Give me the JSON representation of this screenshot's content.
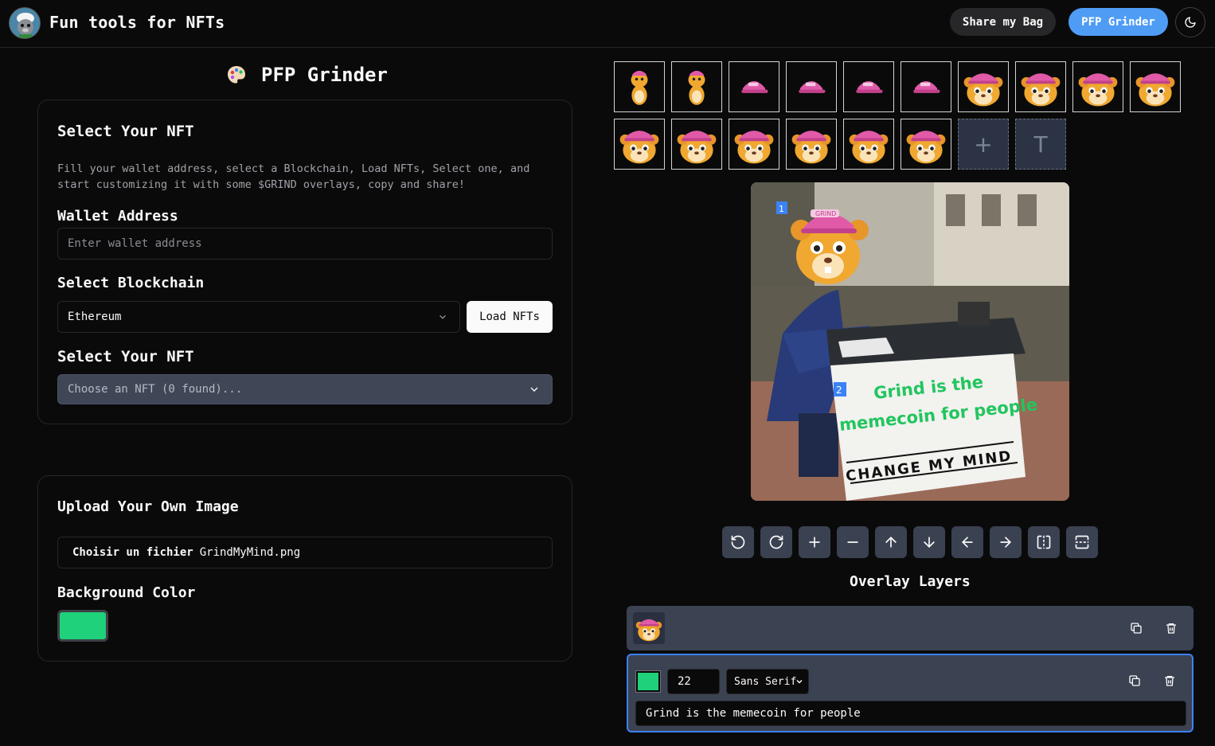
{
  "header": {
    "app_title": "Fun tools for NFTs",
    "share_label": "Share my Bag",
    "pfp_label": "PFP Grinder",
    "theme_icon": "moon-icon"
  },
  "page": {
    "title": "PFP Grinder",
    "title_icon": "palette-icon"
  },
  "select_card": {
    "heading": "Select Your NFT",
    "description": "Fill your wallet address, select a Blockchain, Load NFTs, Select one, and start customizing it with some $GRIND overlays, copy and share!",
    "wallet_label": "Wallet Address",
    "wallet_placeholder": "Enter wallet address",
    "blockchain_label": "Select Blockchain",
    "blockchain_value": "Ethereum",
    "load_label": "Load NFTs",
    "nft_label": "Select Your NFT",
    "nft_placeholder": "Choose an NFT (0 found)..."
  },
  "upload_card": {
    "heading": "Upload Your Own Image",
    "file_button": "Choisir un fichier",
    "file_name": "GrindMyMind.png",
    "bg_label": "Background Color",
    "bg_color": "#1fd17a"
  },
  "stickers": {
    "add_label": "+",
    "text_label": "T"
  },
  "canvas": {
    "meme_line1": "Grind is the",
    "meme_line2": "memecoin for people",
    "sign_text": "CHANGE MY MIND",
    "cap_text": "GRIND",
    "badge1": "1",
    "badge2": "2",
    "text_color": "#22c55e"
  },
  "toolbar": {
    "icons": [
      "rotate-left-icon",
      "rotate-right-icon",
      "zoom-in-icon",
      "zoom-out-icon",
      "arrow-up-icon",
      "arrow-down-icon",
      "arrow-left-icon",
      "arrow-right-icon",
      "flip-horizontal-icon",
      "flip-vertical-icon"
    ]
  },
  "layers": {
    "title": "Overlay Layers",
    "text_layer": {
      "color": "#1fd17a",
      "size": "22",
      "font": "Sans Serif",
      "text": "Grind is the memecoin for people"
    }
  }
}
